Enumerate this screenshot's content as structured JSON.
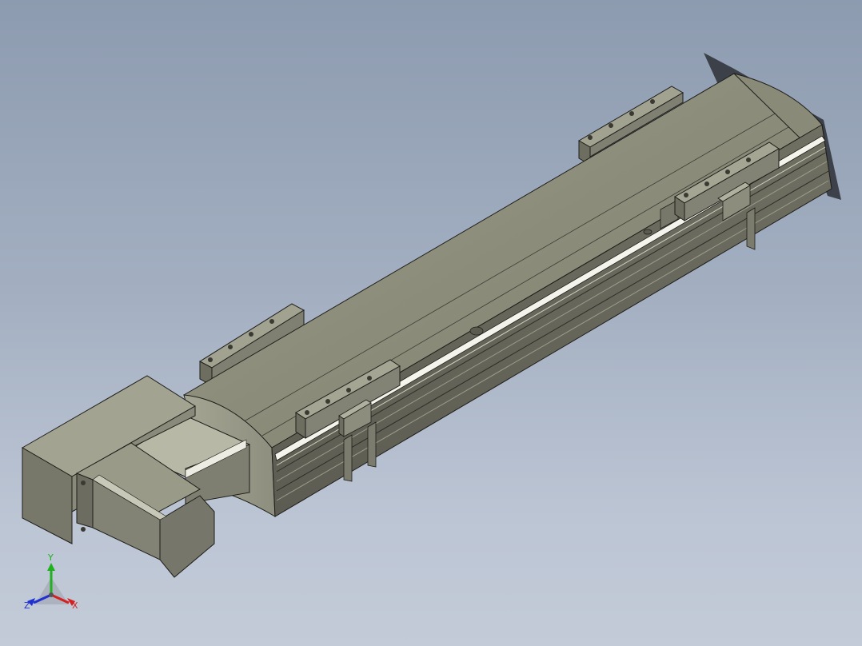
{
  "viewport": {
    "background_top": "#8d9bb0",
    "background_bottom": "#c3cbd8",
    "model_color": "#8c8c7b"
  },
  "triad": {
    "x_label": "X",
    "y_label": "Y",
    "z_label": "Z",
    "x_color": "#d42020",
    "y_color": "#20b020",
    "z_color": "#2030d0"
  }
}
